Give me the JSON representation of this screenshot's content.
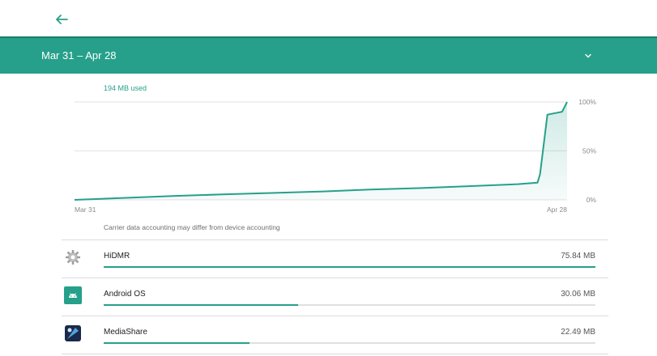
{
  "header": {
    "back_icon": "arrow-left-icon"
  },
  "period": {
    "label": "Mar 31 – Apr 28",
    "dropdown_icon": "chevron-down-icon"
  },
  "usage": {
    "total_label": "194 MB used"
  },
  "chart_data": {
    "type": "area",
    "x_ticks": [
      "Mar 31",
      "Apr 28"
    ],
    "y_ticks": [
      "100%",
      "50%",
      "0%"
    ],
    "x": [
      0,
      0.1,
      0.2,
      0.3,
      0.4,
      0.5,
      0.6,
      0.7,
      0.8,
      0.9,
      0.94,
      0.945,
      0.96,
      0.98,
      0.99,
      1.0
    ],
    "values": [
      0,
      2,
      4,
      5.5,
      7,
      8.5,
      10.5,
      12,
      14,
      16,
      17.5,
      26,
      87,
      89,
      90,
      100
    ],
    "ylim": [
      0,
      100
    ],
    "grid": true,
    "color": "#26a08a"
  },
  "note": "Carrier data accounting may differ from device accounting",
  "apps": [
    {
      "name": "HiDMR",
      "size": "75.84 MB",
      "fraction": 1.0,
      "icon": "gear-icon"
    },
    {
      "name": "Android OS",
      "size": "30.06 MB",
      "fraction": 0.396,
      "icon": "android-icon"
    },
    {
      "name": "MediaShare",
      "size": "22.49 MB",
      "fraction": 0.296,
      "icon": "media-share-icon"
    }
  ]
}
